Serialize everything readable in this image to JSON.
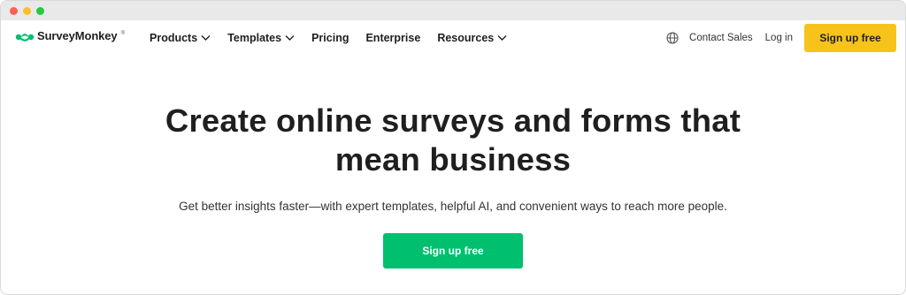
{
  "window": {
    "controls": {
      "close_color": "#ff5f57",
      "minimize_color": "#febc2e",
      "maximize_color": "#28c840"
    }
  },
  "brand": {
    "name": "SurveyMonkey",
    "trademark": "®",
    "accent": "#00bf6f",
    "cta_yellow": "#f7c31b"
  },
  "nav": {
    "items": [
      {
        "label": "Products",
        "has_dropdown": true
      },
      {
        "label": "Templates",
        "has_dropdown": true
      },
      {
        "label": "Pricing",
        "has_dropdown": false
      },
      {
        "label": "Enterprise",
        "has_dropdown": false
      },
      {
        "label": "Resources",
        "has_dropdown": true
      }
    ],
    "language_icon": "globe-icon",
    "contact_sales": "Contact Sales",
    "log_in": "Log in",
    "sign_up": "Sign up free"
  },
  "hero": {
    "title": "Create online surveys and forms that mean business",
    "subtitle": "Get better insights faster—with expert templates, helpful AI, and convenient ways to reach more people.",
    "cta": "Sign up free"
  }
}
